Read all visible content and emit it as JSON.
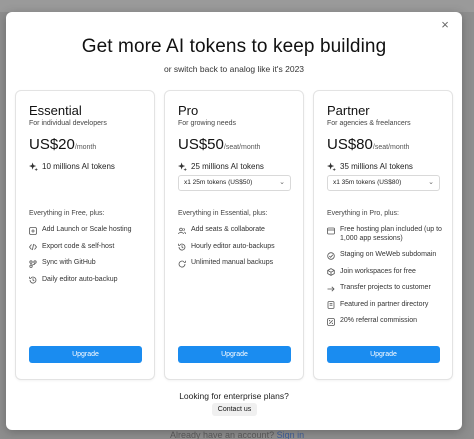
{
  "modal": {
    "title": "Get more AI tokens to keep building",
    "subtitle": "or switch back to analog like it's 2023",
    "close_symbol": "×"
  },
  "plans": [
    {
      "name": "Essential",
      "description": "For individual developers",
      "price": "US$20",
      "period": "/month",
      "tokens": "10 millions AI tokens",
      "select_value": "",
      "features_label": "Everything in Free, plus:",
      "features": [
        {
          "icon": "plus-icon",
          "text": "Add Launch or Scale hosting"
        },
        {
          "icon": "code-icon",
          "text": "Export code & self-host"
        },
        {
          "icon": "sync-icon",
          "text": "Sync with GitHub"
        },
        {
          "icon": "autosave-icon",
          "text": "Daily editor auto-backup"
        }
      ],
      "button": "Upgrade"
    },
    {
      "name": "Pro",
      "description": "For growing needs",
      "price": "US$50",
      "period": "/seat/month",
      "tokens": "25 millions AI tokens",
      "select_value": "x1 25m tokens (US$50)",
      "features_label": "Everything in Essential, plus:",
      "features": [
        {
          "icon": "users-icon",
          "text": "Add seats & collaborate"
        },
        {
          "icon": "autosave-icon",
          "text": "Hourly editor auto-backups"
        },
        {
          "icon": "backup-icon",
          "text": "Unlimited manual backups"
        }
      ],
      "button": "Upgrade"
    },
    {
      "name": "Partner",
      "description": "For agencies & freelancers",
      "price": "US$80",
      "period": "/seat/month",
      "tokens": "35 millions AI tokens",
      "select_value": "x1 35m tokens (US$80)",
      "features_label": "Everything in Pro, plus:",
      "features": [
        {
          "icon": "hosting-icon",
          "text": "Free hosting plan included (up to 1,000 app sessions)"
        },
        {
          "icon": "staging-icon",
          "text": "Staging on WeWeb subdomain"
        },
        {
          "icon": "workspace-icon",
          "text": "Join workspaces for free"
        },
        {
          "icon": "transfer-icon",
          "text": "Transfer projects to customer"
        },
        {
          "icon": "directory-icon",
          "text": "Featured in partner directory"
        },
        {
          "icon": "percent-icon",
          "text": "20% referral commission"
        }
      ],
      "button": "Upgrade"
    }
  ],
  "enterprise": {
    "question": "Looking for enterprise plans?",
    "button": "Contact us"
  },
  "backdrop": {
    "text": "Already have an account?",
    "link": "Sign in"
  },
  "colors": {
    "accent": "#1a8cf0",
    "overlay": "#8e8e8e"
  }
}
